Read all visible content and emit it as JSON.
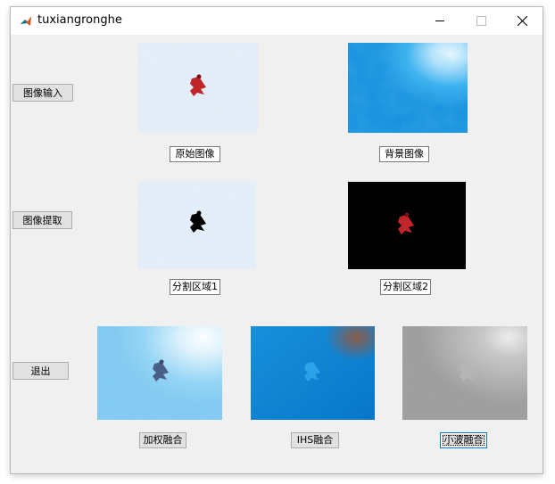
{
  "window": {
    "title": "tuxiangronghe"
  },
  "buttons": {
    "image_input": "图像输入",
    "image_extract": "图像提取",
    "exit": "退出"
  },
  "labels": {
    "original": "原始图像",
    "background": "背景图像",
    "region1": "分割区域1",
    "region2": "分割区域2"
  },
  "fusion_buttons": {
    "weighted": "加权融合",
    "ihs": "IHS融合",
    "wavelet": "小波融合"
  }
}
